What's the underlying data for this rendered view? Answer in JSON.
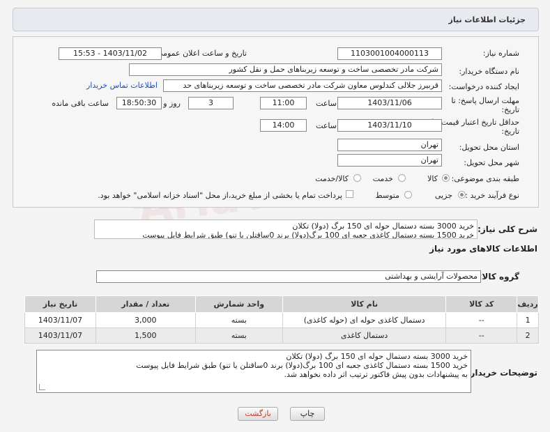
{
  "header": {
    "title": "جزئیات اطلاعات نیاز"
  },
  "fields": {
    "need_number_label": "شماره نیاز:",
    "need_number": "1103001004000113",
    "announce_label": "تاریخ و ساعت اعلان عمومی:",
    "announce_value": "1403/11/02 - 15:53",
    "buyer_org_label": "نام دستگاه خریدار:",
    "buyer_org": "شرکت مادر تخصصی ساخت و توسعه زیربناهای حمل و نقل کشور",
    "requester_label": "ایجاد کننده درخواست:",
    "requester": "قربیرز جلالی کندلوس معاون شرکت مادر تخصصی ساخت و توسعه زیربناهای حد",
    "contact_link": "اطلاعات تماس خریدار",
    "deadline_label": "مهلت ارسال پاسخ: تا",
    "deadline_label2": "تاریخ:",
    "deadline_date": "1403/11/06",
    "time_label": "ساعت",
    "deadline_time": "11:00",
    "days_value": "3",
    "days_label": "روز و",
    "remaining_time": "18:50:30",
    "remaining_label": "ساعت باقی مانده",
    "price_validity_label": "حداقل تاریخ اعتبار قیمت: تا",
    "price_validity_label2": "تاریخ:",
    "price_date": "1403/11/10",
    "price_time_label": "ساعت",
    "price_time": "14:00",
    "province_label": "استان محل تحویل:",
    "province": "تهران",
    "city_label": "شهر محل تحویل:",
    "city": "تهران",
    "category_label": "طبقه بندی موضوعی:",
    "category_options": [
      "کالا",
      "خدمت",
      "کالا/خدمت"
    ],
    "process_label": "نوع فرآیند خرید :",
    "process_options": [
      "جزیی",
      "متوسط"
    ],
    "payment_text": "پرداخت تمام یا بخشی از مبلغ خرید،از محل \"اسناد خزانه اسلامی\" خواهد بود."
  },
  "description": {
    "label": "شرح کلی نیاز:",
    "line1": "خرید 3000 بسته دستمال حوله ای 150 برگ (دولا) تکلان",
    "line2": "خرید 1500 بسته دستمال کاغذی جعبه ای 100 برگ(دولا) برند 0ساقتلن یا تنو) طبق شرایط فایل پیوست"
  },
  "goods_info_title": "اطلاعات کالاهای مورد نیاز",
  "goods_group": {
    "label": "گروه کالا:",
    "value": "محصولات آرایشی و بهداشتی"
  },
  "table": {
    "headers": [
      "ردیف",
      "کد کالا",
      "نام کالا",
      "واحد شمارش",
      "تعداد / مقدار",
      "تاریخ نیاز"
    ],
    "rows": [
      [
        "1",
        "--",
        "دستمال کاغذی حوله ای (حوله کاغذی)",
        "بسته",
        "3,000",
        "1403/11/07"
      ],
      [
        "2",
        "--",
        "دستمال کاغذی",
        "بسته",
        "1,500",
        "1403/11/07"
      ]
    ]
  },
  "buyer_notes": {
    "label": "توضیحات خریدار:",
    "line1": "خرید 3000 بسته دستمال حوله ای 150 برگ (دولا) تکلان",
    "line2": "خرید 1500 بسته دستمال کاغذی جعبه ای 100 برگ(دولا) برند 0ساقتلن یا تنو) طبق شرایط فایل پیوست",
    "line3": "به پیشنهادات بدون پیش فاکتور ترتیب اثر داده نخواهد شد."
  },
  "buttons": {
    "print": "چاپ",
    "back": "بازگشت"
  },
  "watermark": "AriaTender.neT",
  "colors": {
    "link": "#1a4fbf",
    "header_bg": "#e8eaef",
    "back_text": "#c0392b"
  }
}
